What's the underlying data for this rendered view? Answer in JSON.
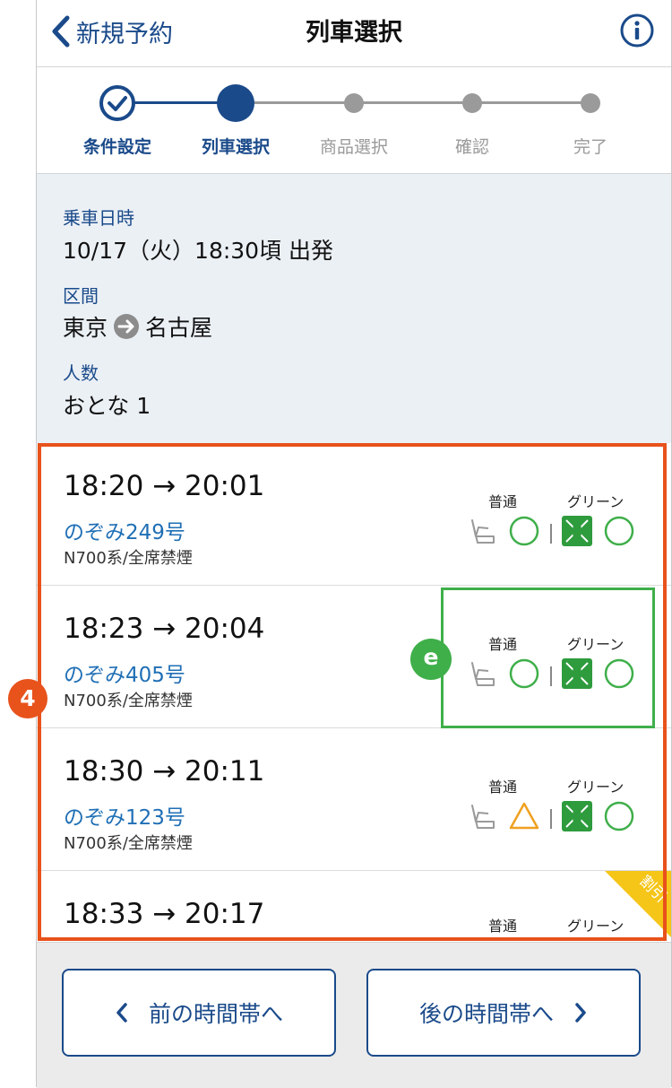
{
  "header": {
    "back_label": "新規予約",
    "title": "列車選択"
  },
  "stepper": {
    "steps": [
      {
        "label": "条件設定",
        "state": "done"
      },
      {
        "label": "列車選択",
        "state": "current"
      },
      {
        "label": "商品選択",
        "state": "todo"
      },
      {
        "label": "確認",
        "state": "todo"
      },
      {
        "label": "完了",
        "state": "todo"
      }
    ]
  },
  "conditions": {
    "datetime_label": "乗車日時",
    "datetime_value": "10/17（火）18:30頃 出発",
    "section_label": "区間",
    "from": "東京",
    "to": "名古屋",
    "people_label": "人数",
    "people_value": "おとな 1"
  },
  "trains": [
    {
      "times": "18:20 → 20:01",
      "name": "のぞみ249号",
      "sub": "N700系/全席禁煙",
      "ordinary_label": "普通",
      "green_label": "グリーン",
      "ordinary": "○",
      "green": "○"
    },
    {
      "times": "18:23 → 20:04",
      "name": "のぞみ405号",
      "sub": "N700系/全席禁煙",
      "ordinary_label": "普通",
      "green_label": "グリーン",
      "ordinary": "○",
      "green": "○"
    },
    {
      "times": "18:30 → 20:11",
      "name": "のぞみ123号",
      "sub": "N700系/全席禁煙",
      "ordinary_label": "普通",
      "green_label": "グリーン",
      "ordinary": "△",
      "green": "○"
    },
    {
      "times": "18:33 → 20:17",
      "ordinary_label": "普通",
      "green_label": "グリーン",
      "sale_label": "割引"
    }
  ],
  "annotations": {
    "badge_4": "4",
    "badge_e": "e"
  },
  "footer": {
    "prev_label": "前の時間帯へ",
    "next_label": "後の時間帯へ"
  },
  "colors": {
    "navy": "#1a4a8a",
    "link": "#1f6fb5",
    "green": "#3faf4a",
    "orange": "#e8521b",
    "triangle": "#f0a020",
    "sale": "#f5c518"
  }
}
